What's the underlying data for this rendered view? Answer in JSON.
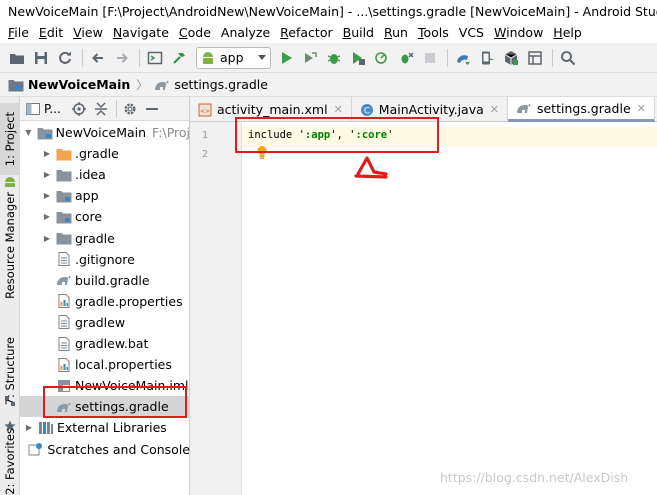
{
  "window": {
    "title": "NewVoiceMain [F:\\Project\\AndroidNew\\NewVoiceMain] - ...\\settings.gradle [NewVoiceMain] - Android Studio"
  },
  "menu": {
    "items": [
      {
        "mnemonic": "F",
        "rest": "ile"
      },
      {
        "mnemonic": "E",
        "rest": "dit"
      },
      {
        "mnemonic": "V",
        "rest": "iew"
      },
      {
        "mnemonic": "N",
        "rest": "avigate"
      },
      {
        "mnemonic": "C",
        "rest": "ode"
      },
      {
        "mnemonic": "",
        "rest": "Analyze"
      },
      {
        "mnemonic": "R",
        "rest": "efactor"
      },
      {
        "mnemonic": "B",
        "rest": "uild"
      },
      {
        "mnemonic": "R",
        "rest": "un"
      },
      {
        "mnemonic": "T",
        "rest": "ools"
      },
      {
        "mnemonic": "",
        "rest": "VCS"
      },
      {
        "mnemonic": "W",
        "rest": "indow"
      },
      {
        "mnemonic": "H",
        "rest": "elp"
      }
    ]
  },
  "toolbar": {
    "run_config_label": "app"
  },
  "breadcrumb": {
    "project": "NewVoiceMain",
    "file": "settings.gradle"
  },
  "left_stripe": {
    "project_tab": "1: Project",
    "resource_manager_tab": "Resource Manager",
    "structure_tab": "7: Structure",
    "favorites_tab": "2: Favorites"
  },
  "project_panel": {
    "header_label": "P...",
    "tree": [
      {
        "label": "NewVoiceMain",
        "suffix": "F:\\Proj",
        "arrow": "open",
        "indent": 0,
        "icon": "module-folder-icon"
      },
      {
        "label": ".gradle",
        "arrow": "closed",
        "indent": 1,
        "icon": "folder-orange-icon"
      },
      {
        "label": ".idea",
        "arrow": "closed",
        "indent": 1,
        "icon": "folder-icon"
      },
      {
        "label": "app",
        "arrow": "closed",
        "indent": 1,
        "icon": "module-folder-icon"
      },
      {
        "label": "core",
        "arrow": "closed",
        "indent": 1,
        "icon": "module-folder-icon"
      },
      {
        "label": "gradle",
        "arrow": "closed",
        "indent": 1,
        "icon": "folder-icon"
      },
      {
        "label": ".gitignore",
        "arrow": "none",
        "indent": 1,
        "icon": "text-file-icon"
      },
      {
        "label": "build.gradle",
        "arrow": "none",
        "indent": 1,
        "icon": "gradle-file-icon"
      },
      {
        "label": "gradle.properties",
        "arrow": "none",
        "indent": 1,
        "icon": "properties-file-icon"
      },
      {
        "label": "gradlew",
        "arrow": "none",
        "indent": 1,
        "icon": "text-file-icon"
      },
      {
        "label": "gradlew.bat",
        "arrow": "none",
        "indent": 1,
        "icon": "text-file-icon"
      },
      {
        "label": "local.properties",
        "arrow": "none",
        "indent": 1,
        "icon": "properties-file-icon"
      },
      {
        "label": "NewVoiceMain.iml",
        "arrow": "none",
        "indent": 1,
        "icon": "iml-file-icon"
      },
      {
        "label": "settings.gradle",
        "arrow": "none",
        "indent": 1,
        "icon": "gradle-file-icon",
        "selected": true
      },
      {
        "label": "External Libraries",
        "arrow": "closed",
        "indent": 0,
        "icon": "library-icon"
      },
      {
        "label": "Scratches and Console",
        "arrow": "none",
        "indent": 0,
        "icon": "scratches-icon"
      }
    ]
  },
  "editor": {
    "tabs": [
      {
        "label": "activity_main.xml",
        "icon": "xml-file-icon",
        "active": false
      },
      {
        "label": "MainActivity.java",
        "icon": "java-class-icon",
        "active": false
      },
      {
        "label": "settings.gradle",
        "icon": "gradle-file-icon",
        "active": true
      }
    ],
    "line_numbers": [
      "1",
      "2"
    ],
    "code": {
      "keyword": "include",
      "q1": "'",
      "str1": ":app",
      "sep": "', '",
      "str2": ":core",
      "q2": "'"
    }
  },
  "watermark": "https://blog.csdn.net/AlexDish",
  "colors": {
    "annotation_red": "#e31b1b",
    "string_green": "#008000",
    "current_line": "#fffae3"
  }
}
